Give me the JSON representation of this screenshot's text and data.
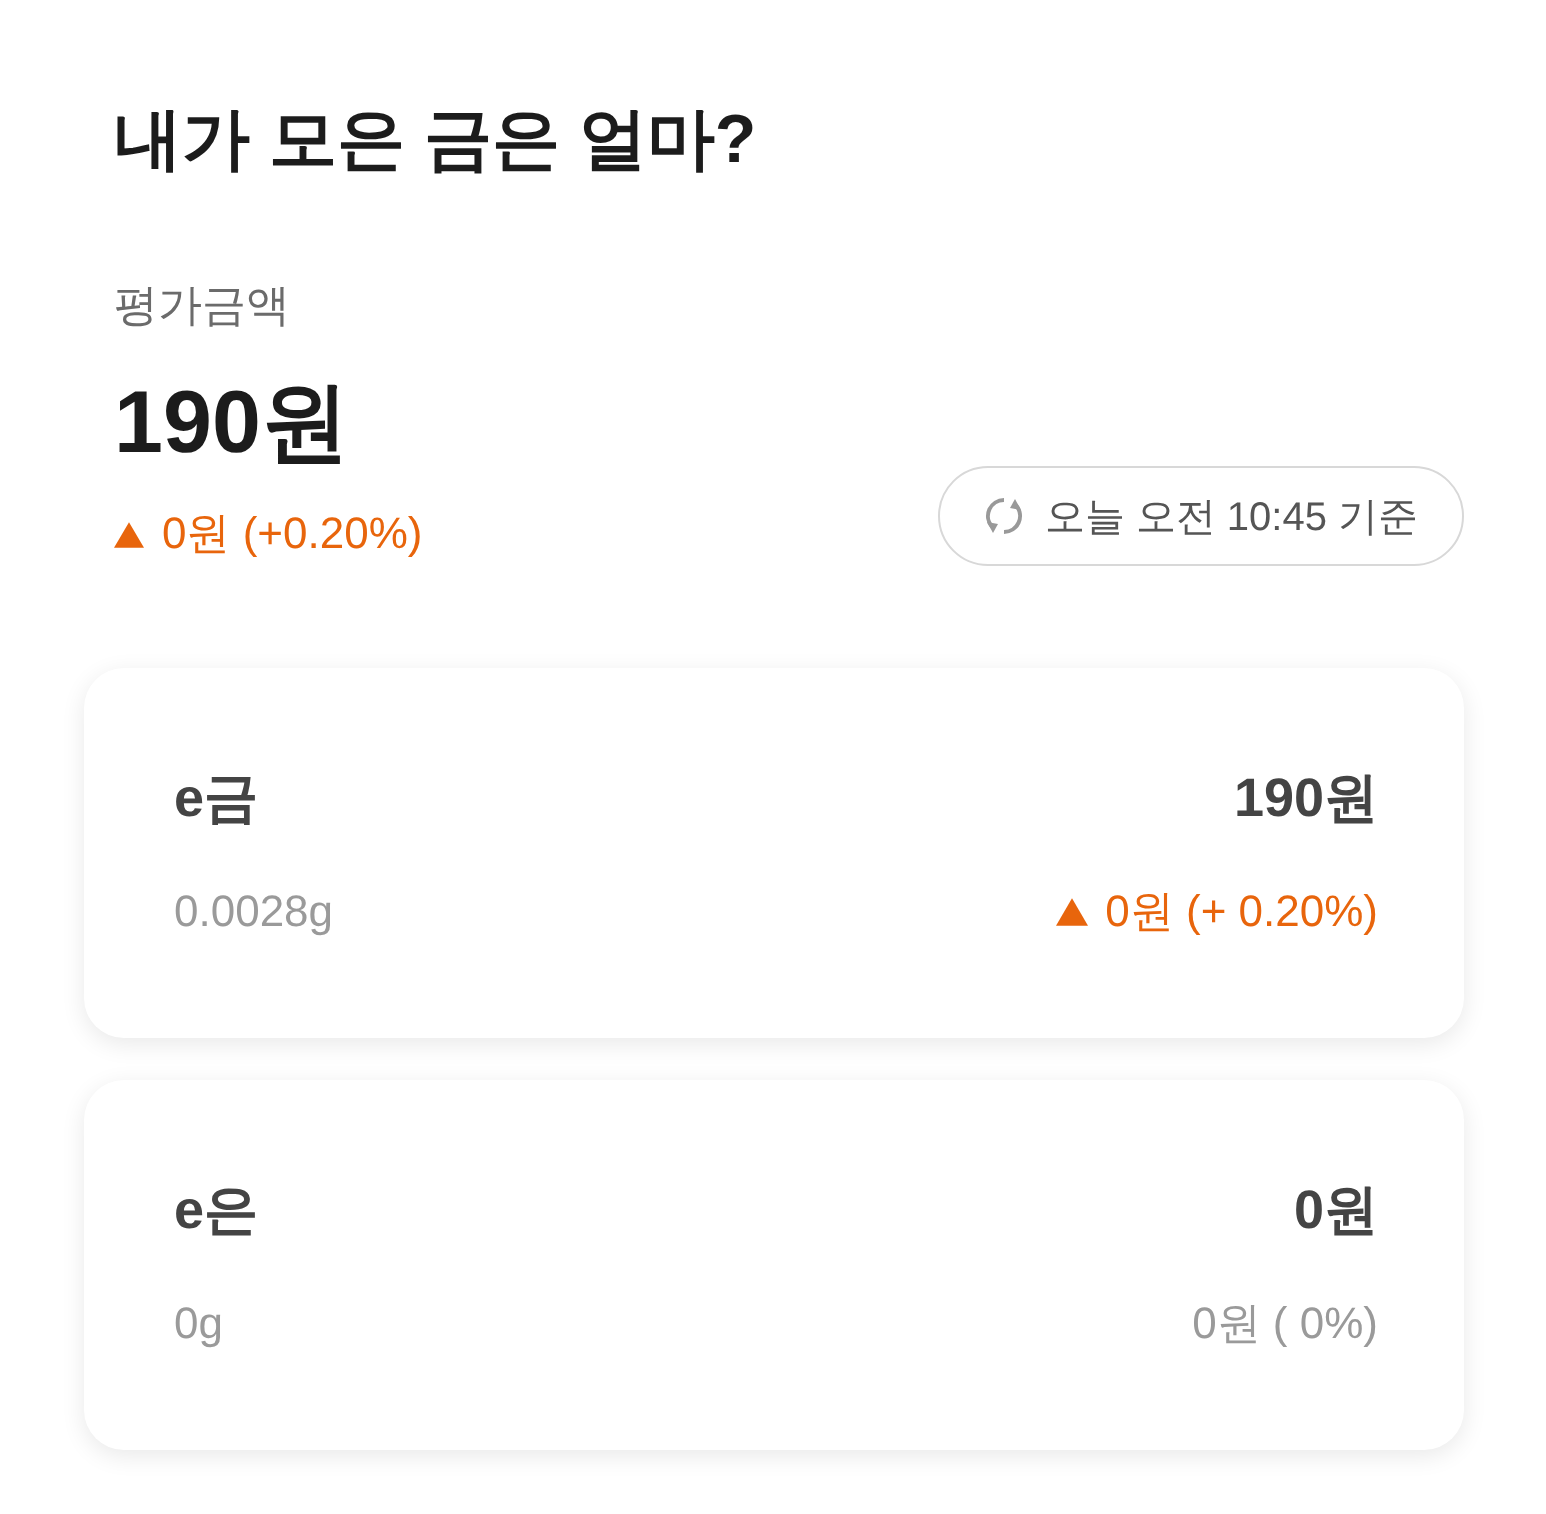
{
  "title": "내가 모은 금은 얼마?",
  "valuation": {
    "label": "평가금액",
    "amount": "190원",
    "change": {
      "rising": true,
      "text": "0원 (+0.20%)"
    },
    "refresh_button": {
      "label": "오늘 오전 10:45 기준"
    }
  },
  "assets": [
    {
      "name": "e금",
      "weight": "0.0028g",
      "amount": "190원",
      "change": {
        "rising": true,
        "text": "0원 (+ 0.20%)"
      }
    },
    {
      "name": "e은",
      "weight": "0g",
      "amount": "0원",
      "change": {
        "rising": false,
        "text": "0원 ( 0%)"
      }
    }
  ]
}
